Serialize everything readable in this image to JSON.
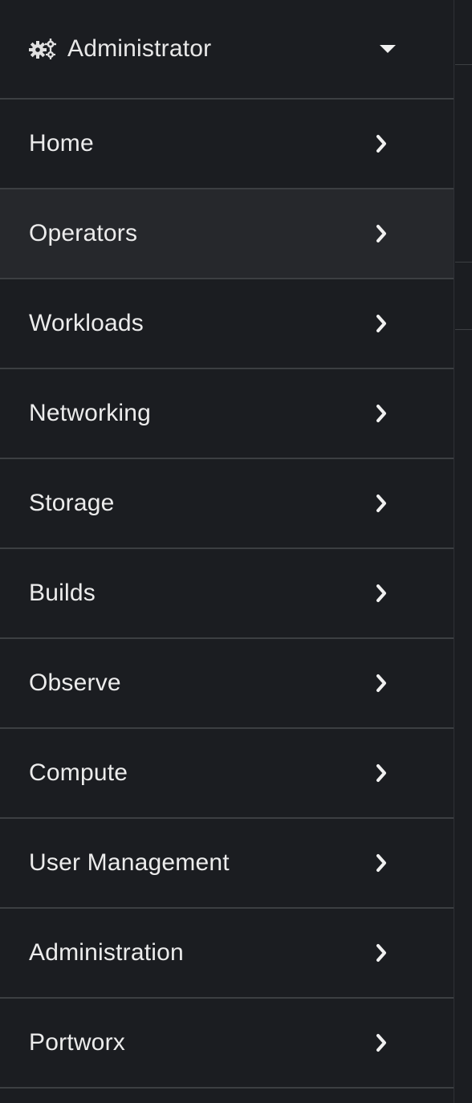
{
  "perspective": {
    "label": "Administrator",
    "icon": "cogs-icon",
    "caret_icon": "caret-down-icon"
  },
  "nav": {
    "active": "Operators",
    "items": [
      {
        "label": "Home"
      },
      {
        "label": "Operators"
      },
      {
        "label": "Workloads"
      },
      {
        "label": "Networking"
      },
      {
        "label": "Storage"
      },
      {
        "label": "Builds"
      },
      {
        "label": "Observe"
      },
      {
        "label": "Compute"
      },
      {
        "label": "User Management"
      },
      {
        "label": "Administration"
      },
      {
        "label": "Portworx"
      }
    ]
  },
  "colors": {
    "background": "#1b1d21",
    "active_background": "#26282c",
    "divider": "#3c3f42",
    "text": "#ececec"
  }
}
